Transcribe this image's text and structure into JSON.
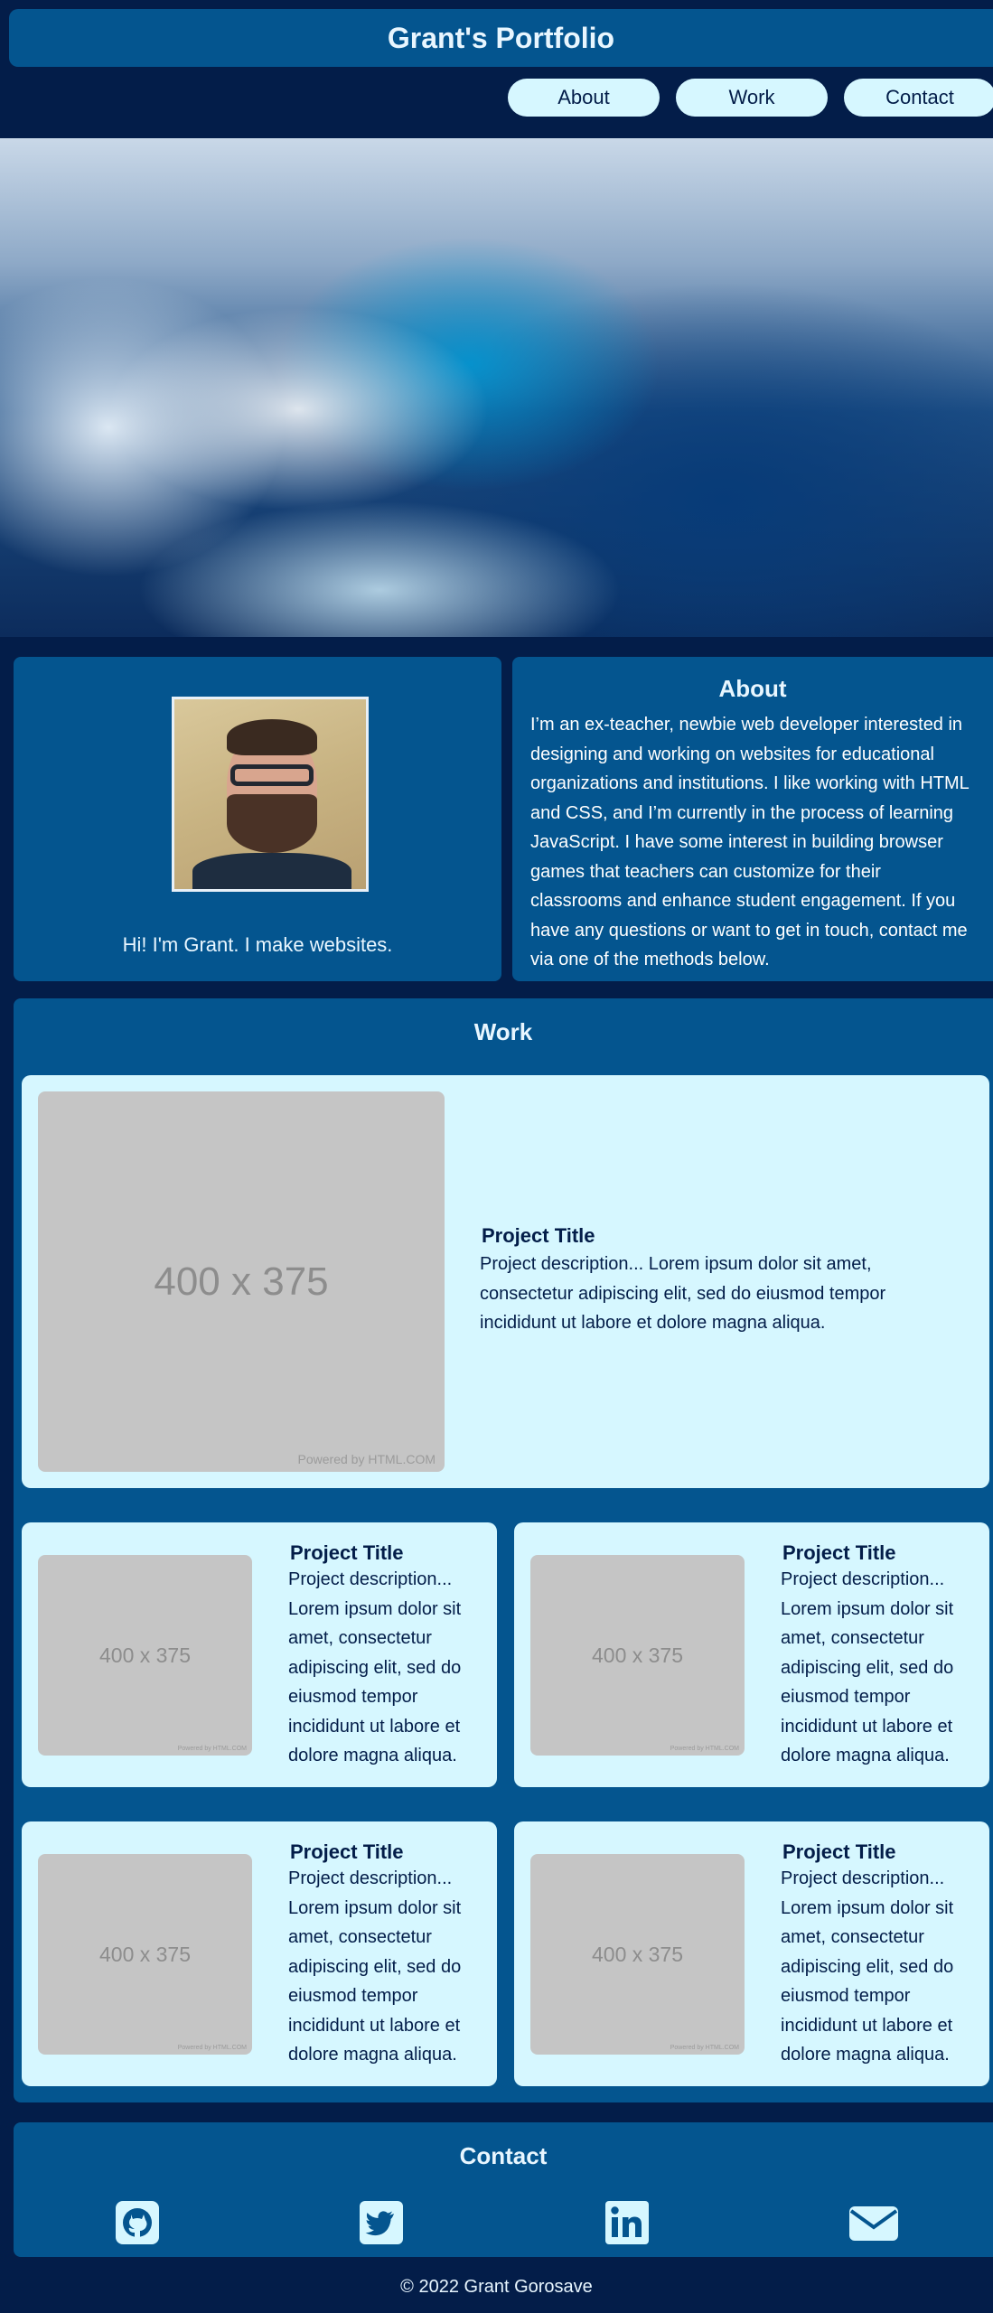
{
  "header": {
    "title": "Grant's Portfolio"
  },
  "nav": {
    "items": [
      "About",
      "Work",
      "Contact"
    ]
  },
  "about": {
    "greeting": "Hi! I'm Grant. I make websites.",
    "heading": "About",
    "text": "I’m an ex-teacher, newbie web developer interested in designing and working on websites for educational organizations and institutions. I like working with HTML and CSS, and I’m currently in the process of learning JavaScript. I have some interest in building browser games that teachers can customize for their classrooms and enhance student engagement. If you have any questions or want to get in touch, contact me via one of the methods below."
  },
  "work": {
    "heading": "Work",
    "placeholder_label": "400 x 375",
    "placeholder_credit": "Powered by HTML.COM",
    "projects": [
      {
        "title": "Project Title",
        "description": "Project description... Lorem ipsum dolor sit amet, consectetur adipiscing elit, sed do eiusmod tempor incididunt ut labore et dolore magna aliqua."
      },
      {
        "title": "Project Title",
        "description": "Project description... Lorem ipsum dolor sit amet, consectetur adipiscing elit, sed do eiusmod tempor incididunt ut labore et dolore magna aliqua."
      },
      {
        "title": "Project Title",
        "description": "Project description... Lorem ipsum dolor sit amet, consectetur adipiscing elit, sed do eiusmod tempor incididunt ut labore et dolore magna aliqua."
      },
      {
        "title": "Project Title",
        "description": "Project description... Lorem ipsum dolor sit amet, consectetur adipiscing elit, sed do eiusmod tempor incididunt ut labore et dolore magna aliqua."
      },
      {
        "title": "Project Title",
        "description": "Project description... Lorem ipsum dolor sit amet, consectetur adipiscing elit, sed do eiusmod tempor incididunt ut labore et dolore magna aliqua."
      }
    ]
  },
  "contact": {
    "heading": "Contact",
    "icons": [
      "github-icon",
      "twitter-icon",
      "linkedin-icon",
      "email-icon"
    ]
  },
  "footer": {
    "text": "© 2022 Grant Gorosave"
  },
  "colors": {
    "background": "#031d49",
    "panel": "#04558f",
    "card": "#d6f7ff",
    "placeholder": "#c5c5c5"
  }
}
